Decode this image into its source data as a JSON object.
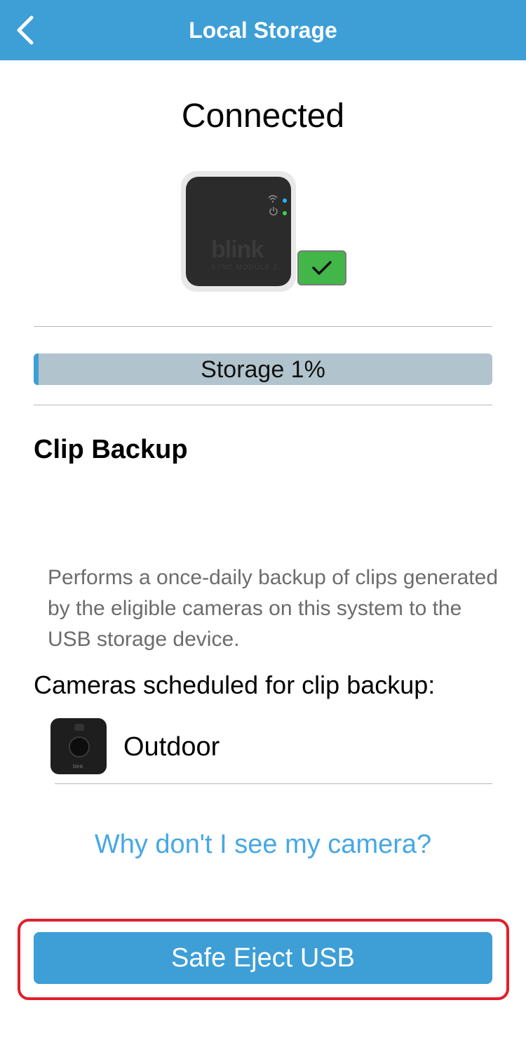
{
  "header": {
    "title": "Local Storage",
    "back_icon": "chevron-left-icon",
    "background_color": "#3d9fd6"
  },
  "status": {
    "heading": "Connected"
  },
  "device": {
    "wordmark": "blink",
    "model_text": "SYNC MODULE 2",
    "status_icon": "checkmark-icon",
    "badge_color": "#43b649"
  },
  "storage": {
    "label": "Storage 1%",
    "used_fraction": 0.01,
    "fill_color": "#3d9fd6",
    "track_color": "#b1c4cd"
  },
  "clip_backup": {
    "title": "Clip Backup",
    "description": "Performs a once-daily backup of clips generated by the eligible cameras on this system to the USB storage device.",
    "cameras_heading": "Cameras scheduled for clip backup:",
    "cameras": [
      {
        "name": "Outdoor",
        "brand": "blink"
      }
    ]
  },
  "help": {
    "link_text": "Why don't I see my camera?",
    "link_color": "#46a8e3"
  },
  "actions": {
    "eject_label": "Safe Eject USB",
    "highlight_color": "#e0202b"
  }
}
